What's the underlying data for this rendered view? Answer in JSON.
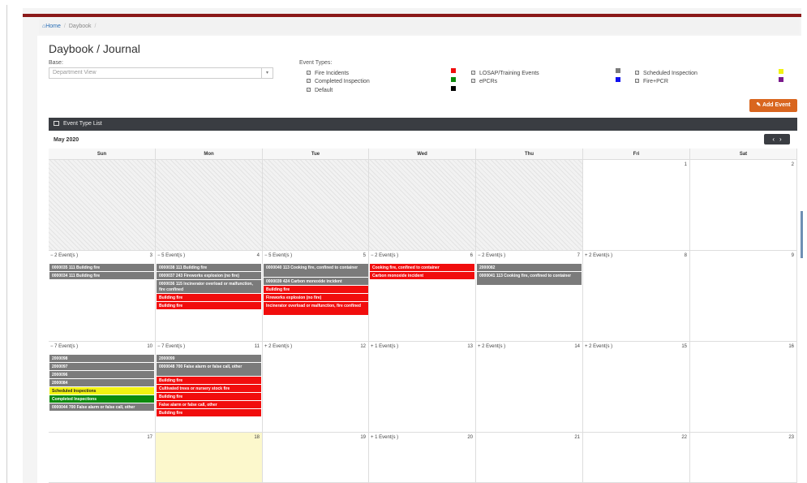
{
  "breadcrumb": {
    "home": "Home",
    "current": "Daybook"
  },
  "page_title": "Daybook / Journal",
  "base": {
    "label": "Base:",
    "value": "Department View"
  },
  "event_types": {
    "label": "Event Types:",
    "items": [
      {
        "label": "Fire Incidents",
        "color": "#f10d0d"
      },
      {
        "label": "Completed Inspection",
        "color": "#0c8a0c"
      },
      {
        "label": "Default",
        "color": "#000000"
      },
      {
        "label": "LOSAP/Training Events",
        "color": "#7b7b7b"
      },
      {
        "label": "ePCRs",
        "color": "#1010f0"
      },
      {
        "label": "Scheduled Inspection",
        "color": "#f2f212"
      },
      {
        "label": "Fire+PCR",
        "color": "#7a1a8c"
      }
    ]
  },
  "add_event_label": "Add Event",
  "panel_title": "Event Type List",
  "month": "May 2020",
  "nav": {
    "prev": "‹",
    "next": "›"
  },
  "days": [
    "Sun",
    "Mon",
    "Tue",
    "Wed",
    "Thu",
    "Fri",
    "Sat"
  ],
  "weeks": [
    {
      "cells": [
        {
          "num": "",
          "out": true
        },
        {
          "num": "",
          "out": true
        },
        {
          "num": "",
          "out": true
        },
        {
          "num": "",
          "out": true
        },
        {
          "num": "",
          "out": true
        },
        {
          "num": "1"
        },
        {
          "num": "2"
        }
      ]
    },
    {
      "cells": [
        {
          "num": "3",
          "count": "− 2 Event(s )",
          "events": [
            {
              "t": "0000035 111 Building fire",
              "c": "gray",
              "h": 1
            },
            {
              "t": "0000034 111 Building fire",
              "c": "gray",
              "h": 1
            }
          ]
        },
        {
          "num": "4",
          "count": "− 5 Event(s )",
          "events": [
            {
              "t": "0000038 111 Building fire",
              "c": "gray",
              "h": 1
            },
            {
              "t": "0000037 243 Fireworks explosion (no fire)",
              "c": "gray",
              "h": 1
            },
            {
              "t": "0000036 115 Incinerator overload or malfunction, fire confined",
              "c": "gray",
              "h": 2
            },
            {
              "t": "Building fire",
              "c": "red",
              "h": 1
            },
            {
              "t": "Building fire",
              "c": "red",
              "h": 1
            }
          ]
        },
        {
          "num": "5",
          "count": "− 5 Event(s )",
          "events": [
            {
              "t": "0000040 113 Cooking fire, confined to container",
              "c": "gray",
              "h": 2
            },
            {
              "t": "0000039 424 Carbon monoxide incident",
              "c": "gray",
              "h": 1
            },
            {
              "t": "Building fire",
              "c": "red",
              "h": 1
            },
            {
              "t": "Fireworks explosion (no fire)",
              "c": "red",
              "h": 1
            },
            {
              "t": "Incinerator overload or malfunction, fire confined",
              "c": "red",
              "h": 2
            }
          ]
        },
        {
          "num": "6",
          "count": "− 2 Event(s )",
          "events": [
            {
              "t": "Cooking fire, confined to container",
              "c": "red",
              "h": 1
            },
            {
              "t": "Carbon monoxide incident",
              "c": "red",
              "h": 1
            }
          ]
        },
        {
          "num": "7",
          "count": "− 2 Event(s )",
          "events": [
            {
              "t": "2000082",
              "c": "gray",
              "h": 1
            },
            {
              "t": "0000041 113 Cooking fire, confined to container",
              "c": "gray",
              "h": 2
            }
          ]
        },
        {
          "num": "8",
          "count": "+ 2 Event(s )"
        },
        {
          "num": "9"
        }
      ]
    },
    {
      "cells": [
        {
          "num": "10",
          "count": "− 7 Event(s )",
          "events": [
            {
              "t": "2000098",
              "c": "gray",
              "h": 1
            },
            {
              "t": "2000097",
              "c": "gray",
              "h": 1
            },
            {
              "t": "2000096",
              "c": "gray",
              "h": 1
            },
            {
              "t": "2000084",
              "c": "gray",
              "h": 1
            },
            {
              "t": "Scheduled Inspections",
              "c": "yellow",
              "h": 1
            },
            {
              "t": "Completed Inspections",
              "c": "green",
              "h": 1
            },
            {
              "t": "0000044 700 False alarm or false call, other",
              "c": "gray",
              "h": 1
            }
          ]
        },
        {
          "num": "11",
          "count": "− 7 Event(s )",
          "events": [
            {
              "t": "2000099",
              "c": "gray",
              "h": 1
            },
            {
              "t": "0000048 700 False alarm or false call, other",
              "c": "gray",
              "h": 2
            },
            {
              "t": "Building fire",
              "c": "red",
              "h": 1
            },
            {
              "t": "Cultivated trees or nursery stock fire",
              "c": "red",
              "h": 1
            },
            {
              "t": "Building fire",
              "c": "red",
              "h": 1
            },
            {
              "t": "False alarm or false call, other",
              "c": "red",
              "h": 1
            },
            {
              "t": "Building fire",
              "c": "red",
              "h": 1
            }
          ]
        },
        {
          "num": "12",
          "count": "+ 2 Event(s )"
        },
        {
          "num": "13",
          "count": "+ 1 Event(s )"
        },
        {
          "num": "14",
          "count": "+ 2 Event(s )"
        },
        {
          "num": "15",
          "count": "+ 2 Event(s )"
        },
        {
          "num": "16"
        }
      ]
    },
    {
      "cells": [
        {
          "num": "17"
        },
        {
          "num": "18",
          "today": true
        },
        {
          "num": "19"
        },
        {
          "num": "20",
          "count": "+ 1 Event(s )"
        },
        {
          "num": "21"
        },
        {
          "num": "22"
        },
        {
          "num": "23"
        }
      ]
    }
  ]
}
